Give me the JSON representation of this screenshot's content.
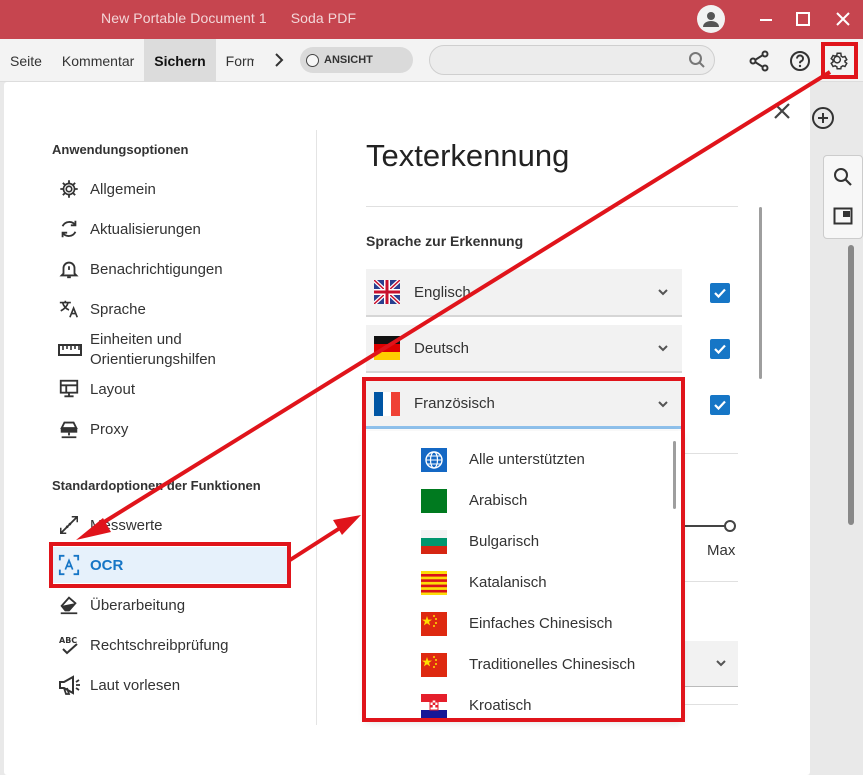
{
  "window": {
    "doc_title": "New Portable Document 1",
    "app_name": "Soda PDF"
  },
  "toolbar": {
    "tabs": [
      "Seite",
      "Kommentar",
      "Sichern",
      "Formular"
    ],
    "active_tab": "Sichern",
    "view_toggle": "ANSICHT",
    "search_placeholder": ""
  },
  "settings": {
    "app_options_heading": "Anwendungsoptionen",
    "app_options": [
      {
        "label": "Allgemein",
        "icon": "gear-icon"
      },
      {
        "label": "Aktualisierungen",
        "icon": "refresh-icon"
      },
      {
        "label": "Benachrichtigungen",
        "icon": "bell-icon"
      },
      {
        "label": "Sprache",
        "icon": "translate-icon"
      },
      {
        "label": "Einheiten und\nOrientierungshilfen",
        "icon": "ruler-icon"
      },
      {
        "label": "Layout",
        "icon": "layout-icon"
      },
      {
        "label": "Proxy",
        "icon": "network-icon"
      }
    ],
    "feature_options_heading": "Standardoptionen der Funktionen",
    "feature_options": [
      {
        "label": "Messwerte",
        "icon": "measure-icon"
      },
      {
        "label": "OCR",
        "icon": "ocr-icon"
      },
      {
        "label": "Überarbeitung",
        "icon": "eraser-icon"
      },
      {
        "label": "Rechtschreibprüfung",
        "icon": "spellcheck-icon"
      },
      {
        "label": "Laut vorlesen",
        "icon": "megaphone-icon"
      }
    ],
    "selected": "OCR"
  },
  "ocr": {
    "title": "Texterkennung",
    "language_label": "Sprache zur Erkennung",
    "languages": [
      {
        "label": "Englisch",
        "checked": true
      },
      {
        "label": "Deutsch",
        "checked": true
      },
      {
        "label": "Französisch",
        "checked": true
      }
    ],
    "dropdown_options": [
      "Alle unterstützten",
      "Arabisch",
      "Bulgarisch",
      "Katalanisch",
      "Einfaches Chinesisch",
      "Traditionelles Chinesisch",
      "Kroatisch"
    ],
    "slider_max_label": "Max"
  },
  "colors": {
    "titlebar": "#c6454f",
    "accent": "#1676c6",
    "annotation": "#e0141b"
  }
}
